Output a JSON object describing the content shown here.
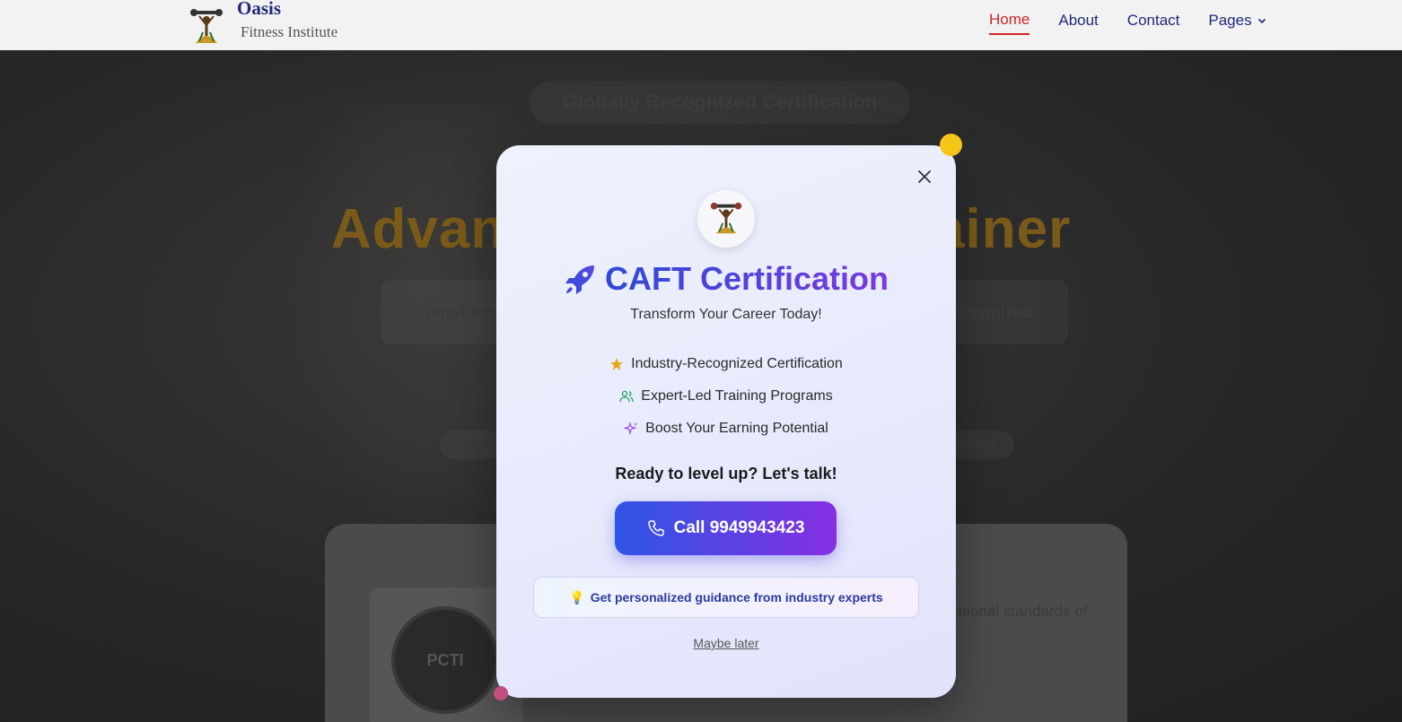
{
  "header": {
    "brand_name": "Oasis",
    "brand_sub": "Fitness Institute",
    "nav": [
      {
        "label": "Home",
        "active": true
      },
      {
        "label": "About",
        "active": false
      },
      {
        "label": "Contact",
        "active": false
      },
      {
        "label": "Pages",
        "active": false,
        "has_dropdown": true
      }
    ]
  },
  "hero": {
    "badge": "Globally Recognized Certification",
    "title": "Advanced Personal Trainer",
    "subtitle_left": "Transform",
    "subtitle_right": "recognized",
    "chips": [
      "Indo",
      "Globally"
    ],
    "card_circle": "PCTI",
    "card_text": "professional recognition, career advancement, and international standards of excellence."
  },
  "modal": {
    "title": "CAFT Certification",
    "subtitle": "Transform Your Career Today!",
    "features": [
      {
        "icon": "star-icon",
        "label": "Industry-Recognized Certification"
      },
      {
        "icon": "users-icon",
        "label": "Expert-Led Training Programs"
      },
      {
        "icon": "sparkles-icon",
        "label": "Boost Your Earning Potential"
      }
    ],
    "ready_text": "Ready to level up? Let's talk!",
    "call_label": "Call 9949943423",
    "tip_icon": "💡",
    "tip_text": "Get personalized guidance from industry experts",
    "dismiss_label": "Maybe later"
  },
  "colors": {
    "accent_blue": "#2e55e6",
    "accent_purple": "#8630e2",
    "nav_active": "#d0262a",
    "nav_text": "#1e2a78",
    "star": "#e6a817",
    "users": "#22a05b",
    "sparkles": "#9b4de0"
  }
}
